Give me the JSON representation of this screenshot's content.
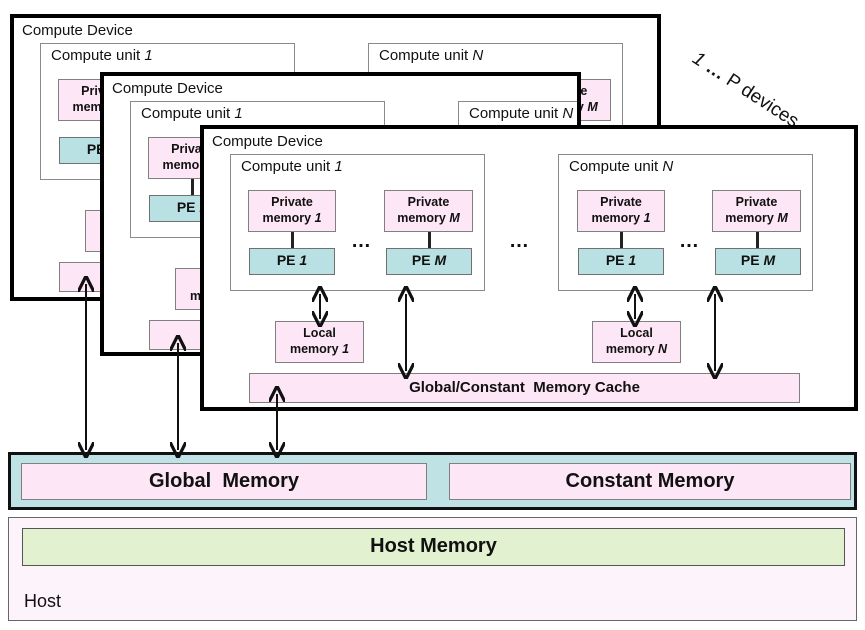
{
  "devices_annotation": {
    "first": "1",
    "dots": "…",
    "rest": "P devices"
  },
  "device": {
    "label": "Compute Device",
    "cu_prefix": "Compute unit",
    "cu_first_index": "1",
    "cu_last_index": "N",
    "private_label": "Private",
    "memory_word": "memory",
    "pe_label": "PE",
    "index_first": "1",
    "index_last_pe": "M",
    "local_label": "Local",
    "cache_label": "Global/Constant  Memory Cache",
    "dots": "…"
  },
  "global_memory": {
    "label": "Global  Memory"
  },
  "constant_memory": {
    "label": "Constant Memory"
  },
  "host": {
    "label": "Host",
    "memory_label": "Host Memory"
  },
  "colors": {
    "memory_pink": "#fde6f6",
    "pe_teal": "#b9e0e2",
    "device_memory_bar": "#bfe2e4",
    "host_memory_green": "#e2f1cf",
    "host_bg": "#fdf4fb"
  }
}
